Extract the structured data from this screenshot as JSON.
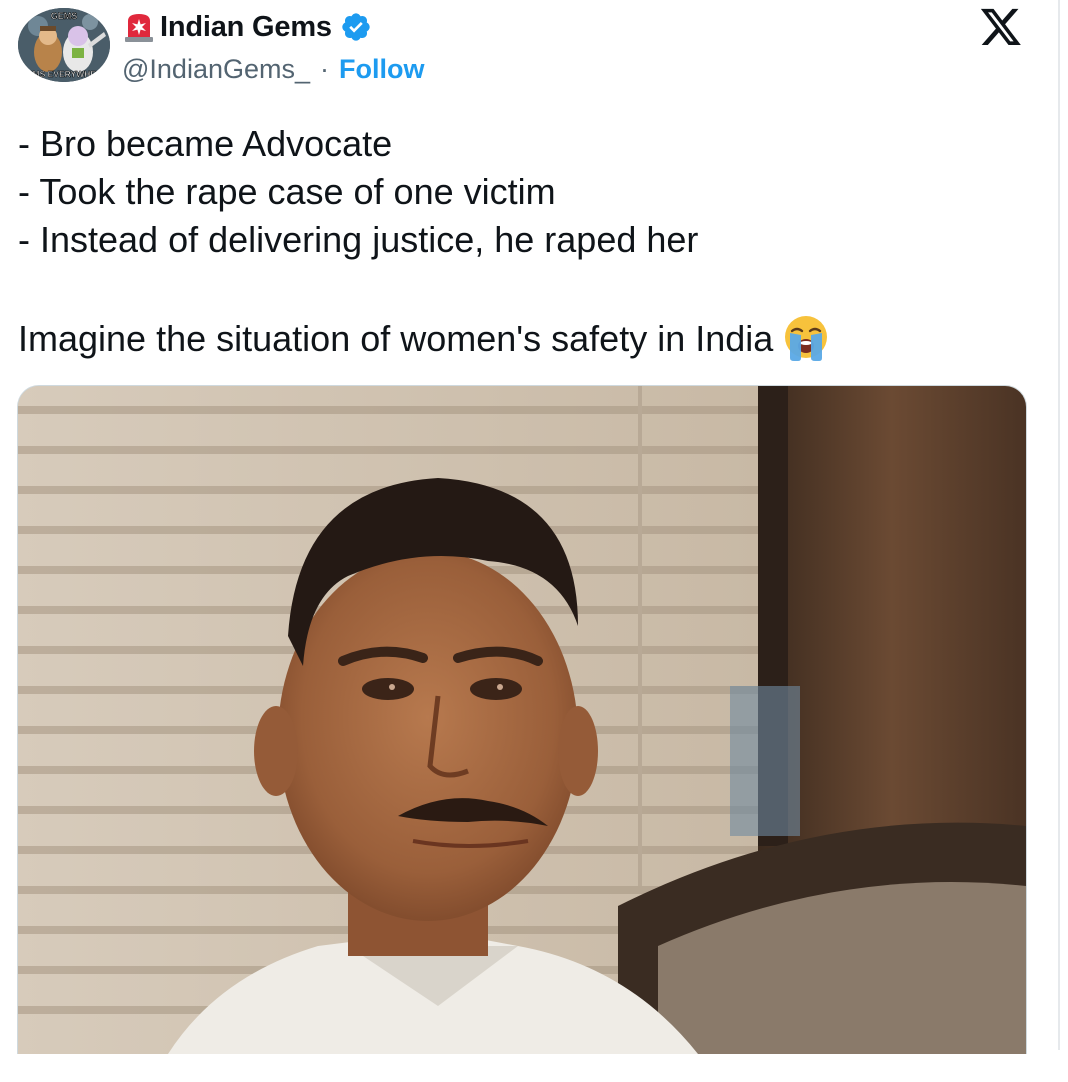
{
  "author": {
    "display_name": "Indian Gems",
    "handle": "@IndianGems_",
    "separator": "·",
    "follow_label": "Follow",
    "verified": true,
    "avatar_texts": [
      "GEMS",
      "GEMS EVERYWHERE"
    ]
  },
  "icons": {
    "siren": "police-light-icon",
    "verified": "verified-badge-icon",
    "platform": "x-logo-icon",
    "emoji": "loudly-crying-face-icon"
  },
  "tweet": {
    "lines": [
      "- Bro became Advocate",
      "- Took the rape case of one victim",
      "- Instead of delivering justice, he raped her"
    ],
    "closing": "Imagine the situation of women's safety in India"
  },
  "media": {
    "kind": "photo",
    "description_hidden": true
  },
  "colors": {
    "accent": "#1d9bf0",
    "text": "#0f1419",
    "secondary": "#536471",
    "border": "#cfd9de"
  }
}
